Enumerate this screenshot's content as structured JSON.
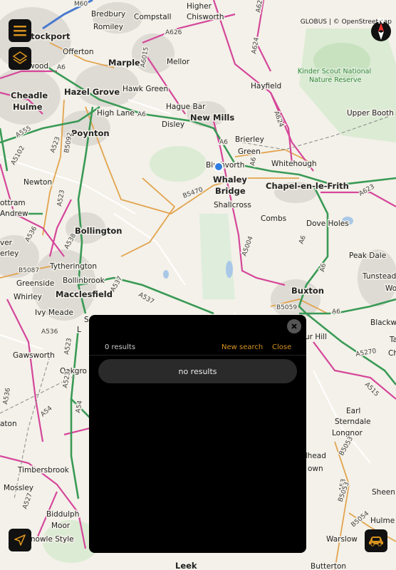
{
  "map": {
    "attribution": "GLOBUS | © OpenStreetMap",
    "compass_letter": "N",
    "places": [
      {
        "name": "Higher",
        "kind": "village"
      },
      {
        "name": "Chisworth",
        "kind": "village"
      },
      {
        "name": "Bredbury",
        "kind": "village"
      },
      {
        "name": "Compstall",
        "kind": "village"
      },
      {
        "name": "Romiley",
        "kind": "village"
      },
      {
        "name": "Stockport",
        "kind": "town"
      },
      {
        "name": "Offerton",
        "kind": "village"
      },
      {
        "name": "wood",
        "kind": "village"
      },
      {
        "name": "Marple",
        "kind": "town"
      },
      {
        "name": "Mellor",
        "kind": "village"
      },
      {
        "name": "Kinder Scout National",
        "kind": "park"
      },
      {
        "name": "Nature Reserve",
        "kind": "park"
      },
      {
        "name": "Cheadle",
        "kind": "town"
      },
      {
        "name": "Hulme",
        "kind": "town"
      },
      {
        "name": "Hazel Grove",
        "kind": "town"
      },
      {
        "name": "Hawk Green",
        "kind": "village"
      },
      {
        "name": "Hayfield",
        "kind": "village"
      },
      {
        "name": "Hague Bar",
        "kind": "village"
      },
      {
        "name": "High Lane",
        "kind": "village"
      },
      {
        "name": "New Mills",
        "kind": "town"
      },
      {
        "name": "Upper Booth",
        "kind": "village"
      },
      {
        "name": "Disley",
        "kind": "village"
      },
      {
        "name": "Poynton",
        "kind": "town"
      },
      {
        "name": "Brierley",
        "kind": "village"
      },
      {
        "name": "Green",
        "kind": "village"
      },
      {
        "name": "Birchvorth",
        "kind": "village"
      },
      {
        "name": "Whitehough",
        "kind": "village"
      },
      {
        "name": "Whaley",
        "kind": "town"
      },
      {
        "name": "Bridge",
        "kind": "town"
      },
      {
        "name": "Chapel-en-le-Frith",
        "kind": "town"
      },
      {
        "name": "Newton",
        "kind": "village"
      },
      {
        "name": "Shallcross",
        "kind": "village"
      },
      {
        "name": "ottram",
        "kind": "village"
      },
      {
        "name": "Andrew",
        "kind": "village"
      },
      {
        "name": "Combs",
        "kind": "village"
      },
      {
        "name": "Dove Holes",
        "kind": "village"
      },
      {
        "name": "Bollington",
        "kind": "town"
      },
      {
        "name": "ver",
        "kind": "village"
      },
      {
        "name": "erley",
        "kind": "village"
      },
      {
        "name": "Peak Dale",
        "kind": "village"
      },
      {
        "name": "Tytherington",
        "kind": "village"
      },
      {
        "name": "Bollinbrook",
        "kind": "village"
      },
      {
        "name": "Tunstead",
        "kind": "village"
      },
      {
        "name": "Greenside",
        "kind": "village"
      },
      {
        "name": "Wo",
        "kind": "village"
      },
      {
        "name": "Macclesfield",
        "kind": "town"
      },
      {
        "name": "Whirley",
        "kind": "village"
      },
      {
        "name": "Buxton",
        "kind": "town"
      },
      {
        "name": "Ivy Meade",
        "kind": "village"
      },
      {
        "name": "Blackw",
        "kind": "village"
      },
      {
        "name": "ur Hill",
        "kind": "village"
      },
      {
        "name": "Gawsworth",
        "kind": "village"
      },
      {
        "name": "Oakgro",
        "kind": "village"
      },
      {
        "name": "Ta",
        "kind": "village"
      },
      {
        "name": "Ch",
        "kind": "village"
      },
      {
        "name": "Earl",
        "kind": "village"
      },
      {
        "name": "Sterndale",
        "kind": "village"
      },
      {
        "name": "Longnor",
        "kind": "village"
      },
      {
        "name": "aton",
        "kind": "village"
      },
      {
        "name": "dhead",
        "kind": "village"
      },
      {
        "name": "own",
        "kind": "village"
      },
      {
        "name": "Timbersbrook",
        "kind": "village"
      },
      {
        "name": "Mossley",
        "kind": "village"
      },
      {
        "name": "Sheen",
        "kind": "village"
      },
      {
        "name": "Hulme",
        "kind": "village"
      },
      {
        "name": "Biddulph",
        "kind": "village"
      },
      {
        "name": "Moor",
        "kind": "village"
      },
      {
        "name": "Warslow",
        "kind": "village"
      },
      {
        "name": "Knowle Style",
        "kind": "village"
      },
      {
        "name": "Leek",
        "kind": "town"
      },
      {
        "name": "Butterton",
        "kind": "village"
      },
      {
        "name": "S",
        "kind": "village"
      },
      {
        "name": "L",
        "kind": "village"
      }
    ],
    "road_labels": [
      "M60",
      "A626",
      "A624",
      "A624",
      "A6",
      "A6015",
      "A6",
      "A6",
      "A555",
      "A523",
      "B5092",
      "A5102",
      "A6",
      "A624",
      "A6",
      "A523",
      "B5470",
      "A5004",
      "A623",
      "A538",
      "A536",
      "B5087",
      "A6",
      "A537",
      "A537",
      "B5059",
      "A6",
      "A536",
      "A523",
      "A5270",
      "A515",
      "A536",
      "A523",
      "A54",
      "A54",
      "B5053",
      "A53",
      "B5053",
      "B5054",
      "A527"
    ]
  },
  "controls": {
    "menu_icon": "hamburger-icon",
    "layers_icon": "layers-icon",
    "locate_icon": "navigation-arrow-icon",
    "route_mode_icon": "car-icon",
    "compass_icon": "compass-icon"
  },
  "search_panel": {
    "count_label": "0 results",
    "new_search_label": "New search",
    "close_label": "Close",
    "empty_message": "no results"
  },
  "colors": {
    "accent": "#d6921e",
    "panel_bg": "#000000",
    "location_dot": "#2f7de1"
  }
}
